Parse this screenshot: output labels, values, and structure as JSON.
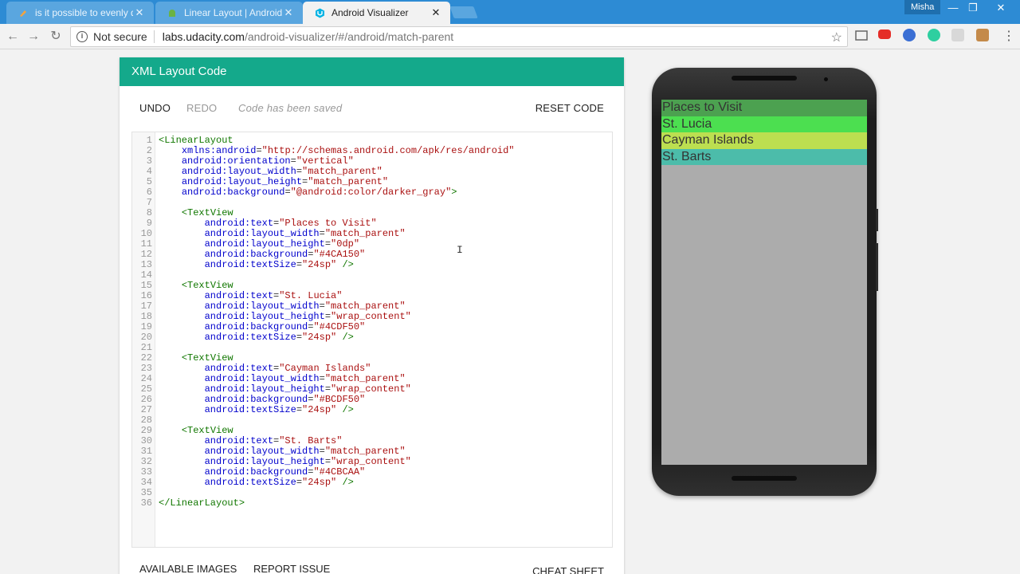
{
  "browser": {
    "tabs": [
      {
        "title": "is it possible to evenly di",
        "favicon_color": "#f3a33f",
        "active": false
      },
      {
        "title": "Linear Layout | Android D",
        "favicon_color": "#6ab344",
        "active": false
      },
      {
        "title": "Android Visualizer",
        "favicon_color": "#02b3e4",
        "active": true
      }
    ],
    "close_glyph": "✕",
    "user_name": "Misha",
    "window_buttons": {
      "minimize": "—",
      "maximize": "❐",
      "close": "✕"
    },
    "security_label": "Not secure",
    "url_host": "labs.udacity.com",
    "url_path": "/android-visualizer/#/android/match-parent",
    "icons": [
      "back-icon",
      "forward-icon",
      "reload-icon",
      "info-icon",
      "star-icon",
      "cast-icon",
      "menu-icon"
    ]
  },
  "panel": {
    "title": "XML Layout Code",
    "undo": "UNDO",
    "redo": "REDO",
    "status": "Code has been saved",
    "reset": "RESET CODE"
  },
  "code_lines": [
    [
      [
        "t-tag",
        "<LinearLayout"
      ]
    ],
    [
      [
        "t-plain",
        "    "
      ],
      [
        "t-attr",
        "xmlns:android"
      ],
      [
        "t-plain",
        "="
      ],
      [
        "t-str",
        "\"http://schemas.android.com/apk/res/android\""
      ]
    ],
    [
      [
        "t-plain",
        "    "
      ],
      [
        "t-attr",
        "android:orientation"
      ],
      [
        "t-plain",
        "="
      ],
      [
        "t-str",
        "\"vertical\""
      ]
    ],
    [
      [
        "t-plain",
        "    "
      ],
      [
        "t-attr",
        "android:layout_width"
      ],
      [
        "t-plain",
        "="
      ],
      [
        "t-str",
        "\"match_parent\""
      ]
    ],
    [
      [
        "t-plain",
        "    "
      ],
      [
        "t-attr",
        "android:layout_height"
      ],
      [
        "t-plain",
        "="
      ],
      [
        "t-str",
        "\"match_parent\""
      ]
    ],
    [
      [
        "t-plain",
        "    "
      ],
      [
        "t-attr",
        "android:background"
      ],
      [
        "t-plain",
        "="
      ],
      [
        "t-str",
        "\"@android:color/darker_gray\""
      ],
      [
        "t-tag",
        ">"
      ]
    ],
    [
      [
        "t-plain",
        ""
      ]
    ],
    [
      [
        "t-plain",
        "    "
      ],
      [
        "t-tag",
        "<TextView"
      ]
    ],
    [
      [
        "t-plain",
        "        "
      ],
      [
        "t-attr",
        "android:text"
      ],
      [
        "t-plain",
        "="
      ],
      [
        "t-str",
        "\"Places to Visit\""
      ]
    ],
    [
      [
        "t-plain",
        "        "
      ],
      [
        "t-attr",
        "android:layout_width"
      ],
      [
        "t-plain",
        "="
      ],
      [
        "t-str",
        "\"match_parent\""
      ]
    ],
    [
      [
        "t-plain",
        "        "
      ],
      [
        "t-attr",
        "android:layout_height"
      ],
      [
        "t-plain",
        "="
      ],
      [
        "t-str",
        "\"0dp\""
      ]
    ],
    [
      [
        "t-plain",
        "        "
      ],
      [
        "t-attr",
        "android:background"
      ],
      [
        "t-plain",
        "="
      ],
      [
        "t-str",
        "\"#4CA150\""
      ]
    ],
    [
      [
        "t-plain",
        "        "
      ],
      [
        "t-attr",
        "android:textSize"
      ],
      [
        "t-plain",
        "="
      ],
      [
        "t-str",
        "\"24sp\""
      ],
      [
        "t-plain",
        " "
      ],
      [
        "t-tag",
        "/>"
      ]
    ],
    [
      [
        "t-plain",
        ""
      ]
    ],
    [
      [
        "t-plain",
        "    "
      ],
      [
        "t-tag",
        "<TextView"
      ]
    ],
    [
      [
        "t-plain",
        "        "
      ],
      [
        "t-attr",
        "android:text"
      ],
      [
        "t-plain",
        "="
      ],
      [
        "t-str",
        "\"St. Lucia\""
      ]
    ],
    [
      [
        "t-plain",
        "        "
      ],
      [
        "t-attr",
        "android:layout_width"
      ],
      [
        "t-plain",
        "="
      ],
      [
        "t-str",
        "\"match_parent\""
      ]
    ],
    [
      [
        "t-plain",
        "        "
      ],
      [
        "t-attr",
        "android:layout_height"
      ],
      [
        "t-plain",
        "="
      ],
      [
        "t-str",
        "\"wrap_content\""
      ]
    ],
    [
      [
        "t-plain",
        "        "
      ],
      [
        "t-attr",
        "android:background"
      ],
      [
        "t-plain",
        "="
      ],
      [
        "t-str",
        "\"#4CDF50\""
      ]
    ],
    [
      [
        "t-plain",
        "        "
      ],
      [
        "t-attr",
        "android:textSize"
      ],
      [
        "t-plain",
        "="
      ],
      [
        "t-str",
        "\"24sp\""
      ],
      [
        "t-plain",
        " "
      ],
      [
        "t-tag",
        "/>"
      ]
    ],
    [
      [
        "t-plain",
        ""
      ]
    ],
    [
      [
        "t-plain",
        "    "
      ],
      [
        "t-tag",
        "<TextView"
      ]
    ],
    [
      [
        "t-plain",
        "        "
      ],
      [
        "t-attr",
        "android:text"
      ],
      [
        "t-plain",
        "="
      ],
      [
        "t-str",
        "\"Cayman Islands\""
      ]
    ],
    [
      [
        "t-plain",
        "        "
      ],
      [
        "t-attr",
        "android:layout_width"
      ],
      [
        "t-plain",
        "="
      ],
      [
        "t-str",
        "\"match_parent\""
      ]
    ],
    [
      [
        "t-plain",
        "        "
      ],
      [
        "t-attr",
        "android:layout_height"
      ],
      [
        "t-plain",
        "="
      ],
      [
        "t-str",
        "\"wrap_content\""
      ]
    ],
    [
      [
        "t-plain",
        "        "
      ],
      [
        "t-attr",
        "android:background"
      ],
      [
        "t-plain",
        "="
      ],
      [
        "t-str",
        "\"#BCDF50\""
      ]
    ],
    [
      [
        "t-plain",
        "        "
      ],
      [
        "t-attr",
        "android:textSize"
      ],
      [
        "t-plain",
        "="
      ],
      [
        "t-str",
        "\"24sp\""
      ],
      [
        "t-plain",
        " "
      ],
      [
        "t-tag",
        "/>"
      ]
    ],
    [
      [
        "t-plain",
        ""
      ]
    ],
    [
      [
        "t-plain",
        "    "
      ],
      [
        "t-tag",
        "<TextView"
      ]
    ],
    [
      [
        "t-plain",
        "        "
      ],
      [
        "t-attr",
        "android:text"
      ],
      [
        "t-plain",
        "="
      ],
      [
        "t-str",
        "\"St. Barts\""
      ]
    ],
    [
      [
        "t-plain",
        "        "
      ],
      [
        "t-attr",
        "android:layout_width"
      ],
      [
        "t-plain",
        "="
      ],
      [
        "t-str",
        "\"match_parent\""
      ]
    ],
    [
      [
        "t-plain",
        "        "
      ],
      [
        "t-attr",
        "android:layout_height"
      ],
      [
        "t-plain",
        "="
      ],
      [
        "t-str",
        "\"wrap_content\""
      ]
    ],
    [
      [
        "t-plain",
        "        "
      ],
      [
        "t-attr",
        "android:background"
      ],
      [
        "t-plain",
        "="
      ],
      [
        "t-str",
        "\"#4CBCAA\""
      ]
    ],
    [
      [
        "t-plain",
        "        "
      ],
      [
        "t-attr",
        "android:textSize"
      ],
      [
        "t-plain",
        "="
      ],
      [
        "t-str",
        "\"24sp\""
      ],
      [
        "t-plain",
        " "
      ],
      [
        "t-tag",
        "/>"
      ]
    ],
    [
      [
        "t-plain",
        ""
      ]
    ],
    [
      [
        "t-tag",
        "</LinearLayout>"
      ]
    ]
  ],
  "footer": {
    "available_images": "AVAILABLE IMAGES",
    "report_issue": "REPORT ISSUE",
    "cheat_sheet": "CHEAT SHEET"
  },
  "phone": {
    "screen_background": "#acacac",
    "text_views": [
      {
        "text": "Places to Visit",
        "color": "#4CA150"
      },
      {
        "text": "St. Lucia",
        "color": "#4CDF50"
      },
      {
        "text": "Cayman Islands",
        "color": "#BCDF50"
      },
      {
        "text": "St. Barts",
        "color": "#4CBCAA"
      }
    ]
  },
  "colors": {
    "accent": "#14a98b",
    "tabbar": "#2d8bd4"
  }
}
